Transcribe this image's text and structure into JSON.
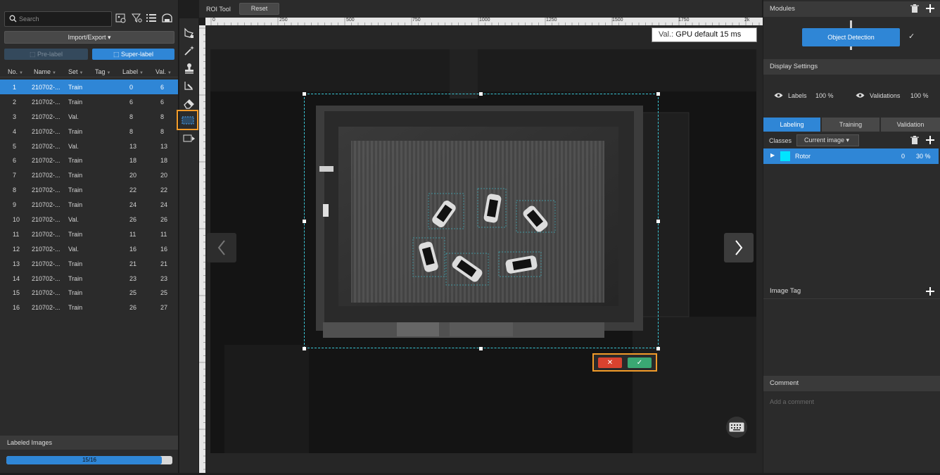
{
  "left": {
    "search_placeholder": "Search",
    "import_export": "Import/Export",
    "pre_label": "Pre-label",
    "super_label": "Super-label",
    "columns": [
      "No.",
      "Name",
      "Set",
      "Tag",
      "Label",
      "Val."
    ],
    "rows": [
      {
        "no": "1",
        "name": "210702-...",
        "set": "Train",
        "tag": "",
        "label": "0",
        "val": "6"
      },
      {
        "no": "2",
        "name": "210702-...",
        "set": "Train",
        "tag": "",
        "label": "6",
        "val": "6"
      },
      {
        "no": "3",
        "name": "210702-...",
        "set": "Val.",
        "tag": "",
        "label": "8",
        "val": "8"
      },
      {
        "no": "4",
        "name": "210702-...",
        "set": "Train",
        "tag": "",
        "label": "8",
        "val": "8"
      },
      {
        "no": "5",
        "name": "210702-...",
        "set": "Val.",
        "tag": "",
        "label": "13",
        "val": "13"
      },
      {
        "no": "6",
        "name": "210702-...",
        "set": "Train",
        "tag": "",
        "label": "18",
        "val": "18"
      },
      {
        "no": "7",
        "name": "210702-...",
        "set": "Train",
        "tag": "",
        "label": "20",
        "val": "20"
      },
      {
        "no": "8",
        "name": "210702-...",
        "set": "Train",
        "tag": "",
        "label": "22",
        "val": "22"
      },
      {
        "no": "9",
        "name": "210702-...",
        "set": "Train",
        "tag": "",
        "label": "24",
        "val": "24"
      },
      {
        "no": "10",
        "name": "210702-...",
        "set": "Val.",
        "tag": "",
        "label": "26",
        "val": "26"
      },
      {
        "no": "11",
        "name": "210702-...",
        "set": "Train",
        "tag": "",
        "label": "11",
        "val": "11"
      },
      {
        "no": "12",
        "name": "210702-...",
        "set": "Val.",
        "tag": "",
        "label": "16",
        "val": "16"
      },
      {
        "no": "13",
        "name": "210702-...",
        "set": "Train",
        "tag": "",
        "label": "21",
        "val": "21"
      },
      {
        "no": "14",
        "name": "210702-...",
        "set": "Train",
        "tag": "",
        "label": "23",
        "val": "23"
      },
      {
        "no": "15",
        "name": "210702-...",
        "set": "Train",
        "tag": "",
        "label": "25",
        "val": "25"
      },
      {
        "no": "16",
        "name": "210702-...",
        "set": "Train",
        "tag": "",
        "label": "26",
        "val": "27"
      }
    ],
    "labeled_images_title": "Labeled Images",
    "progress_text": "15/16",
    "progress_fraction": 0.9375
  },
  "toolbar": {
    "roi_tool": "ROI Tool",
    "reset": "Reset",
    "tools": [
      "polygon-tool-icon",
      "magic-wand-icon",
      "stamp-icon",
      "brush-tool-icon",
      "eraser-icon",
      "roi-rect-icon",
      "roi-apply-icon"
    ]
  },
  "canvas": {
    "ruler_labels": [
      "0",
      "250",
      "500",
      "750",
      "1000",
      "1250",
      "1500",
      "1750",
      "2k"
    ],
    "val_key": "Val.:",
    "val_value": "GPU default 15 ms",
    "cancel_glyph": "✕",
    "confirm_glyph": "✓"
  },
  "right": {
    "modules_title": "Modules",
    "module_name": "Object Detection",
    "display_settings": "Display Settings",
    "labels_text": "Labels",
    "labels_pct": "100 %",
    "validations_text": "Validations",
    "validations_pct": "100 %",
    "tabs": [
      "Labeling",
      "Training",
      "Validation"
    ],
    "classes_title": "Classes",
    "classes_filter": "Current image",
    "class_name": "Rotor",
    "class_count": "0",
    "class_pct": "30 %",
    "class_color": "#00e5ff",
    "image_tag_title": "Image Tag",
    "comment_title": "Comment",
    "comment_placeholder": "Add a comment"
  },
  "colors": {
    "accent": "#2f86d6",
    "highlight": "#f29b29",
    "cancel": "#d8422f",
    "confirm": "#3aa873"
  }
}
